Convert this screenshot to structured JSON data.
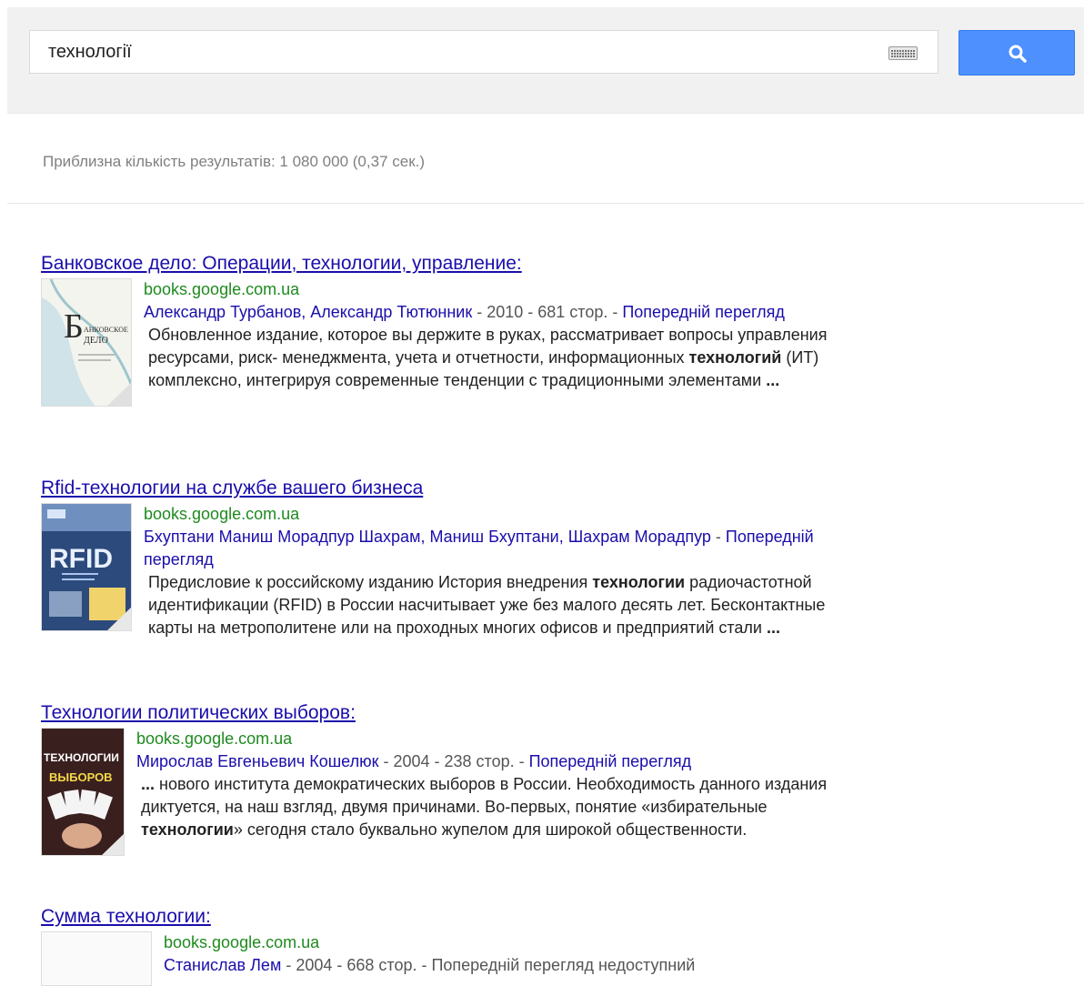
{
  "search": {
    "query": "технології",
    "keyboard_icon": "keyboard-icon",
    "button_icon": "search-icon"
  },
  "stats": "Приблизна кількість результатів: 1 080 000 (0,37 сек.)",
  "colors": {
    "link": "#1a0dab",
    "url_green": "#1e8a1e",
    "button_blue": "#4d90fe"
  },
  "results": [
    {
      "title": "Банковское дело: Операции, технологии, управление:",
      "url": "books.google.com.ua",
      "authors": "Александр Турбанов, Александр Тютюнник",
      "details": " - 2010 - 681 стор. - ",
      "preview": "Попередній перегляд",
      "snippet_before": "Обновленное издание, которое вы держите в руках, рассматривает вопросы управления ресурсами, риск- менеджмента, учета и отчетности, информационных ",
      "snippet_bold": "технологий",
      "snippet_after": " (ИТ) комплексно, интегрируя современные тенденции с традиционными элементами ",
      "snippet_ellipsis": "..."
    },
    {
      "title": "Rfid-технологии на службе вашего бизнеса",
      "url": "books.google.com.ua",
      "authors": "Бхуптани Маниш Морадпур Шахрам, Маниш Бхуптани, Шахрам Морадпур",
      "details": " - ",
      "preview": "Попередній перегляд",
      "snippet_before": "Предисловие к российскому изданию История внедрения ",
      "snippet_bold": "технологии",
      "snippet_after": " радиочастотной идентификации (RFID) в России насчитывает уже без малого десять лет. Бесконтактные карты на метрополитене или на проходных многих офисов и предприятий стали ",
      "snippet_ellipsis": "..."
    },
    {
      "title": "Технологии политических выборов:",
      "url": "books.google.com.ua",
      "authors": "Мирослав Евгеньевич Кошелюк",
      "details": " - 2004 - 238 стор. - ",
      "preview": "Попередній перегляд",
      "snippet_lead": "...",
      "snippet_before": " нового института демократических выборов в России. Необходимость данного издания диктуется, на наш взгляд, двумя причинами. Во-первых, понятие «избирательные ",
      "snippet_bold": "технологии",
      "snippet_after": "» сегодня стало буквально жупелом для широкой общественности."
    },
    {
      "title": "Сумма технологии:",
      "url": "books.google.com.ua",
      "authors": "Станислав Лем",
      "details": " - 2004 - 668 стор. - Попередній перегляд недоступний"
    }
  ]
}
